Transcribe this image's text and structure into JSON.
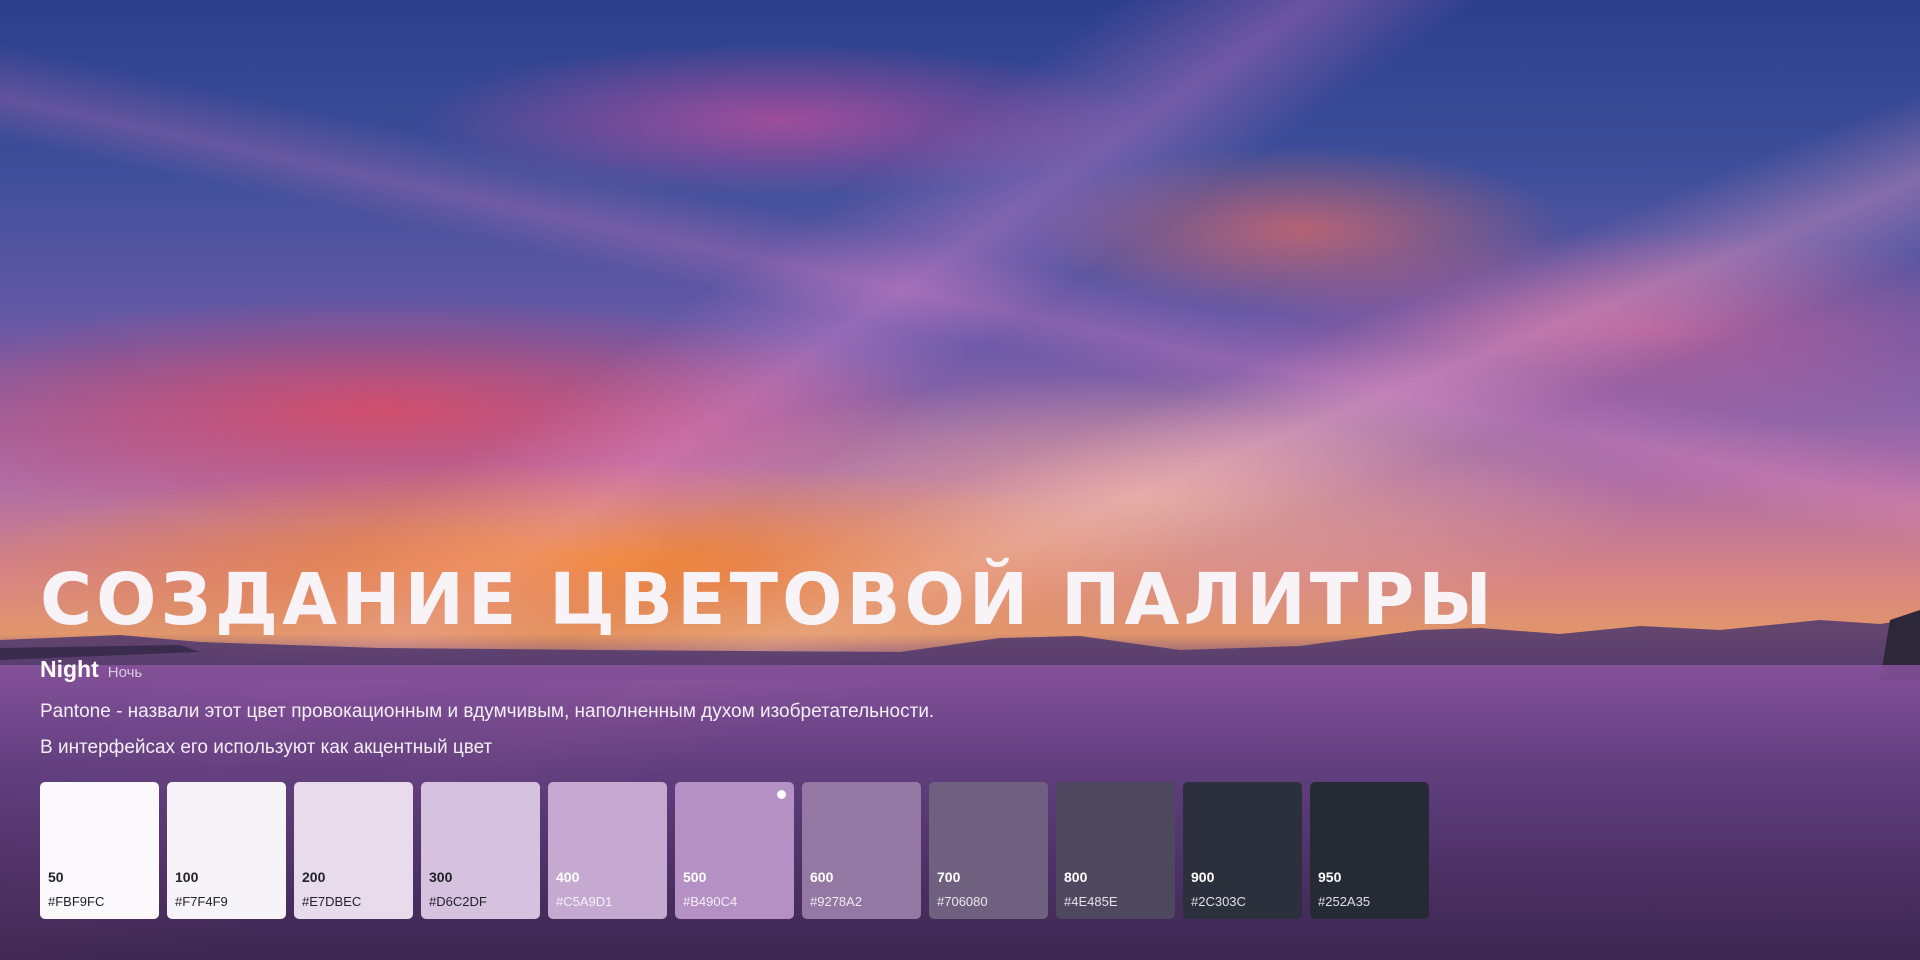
{
  "title": "СОЗДАНИЕ ЦВЕТОВОЙ ПАЛИТРЫ",
  "color_name": "Night",
  "color_name_ru": "Ночь",
  "description": [
    "Pantone - назвали этот цвет провокационным и вдумчивым, наполненным духом изобретательности.",
    "В интерфейсах его используют как акцентный цвет"
  ],
  "swatches": [
    {
      "label": "50",
      "hex": "#FBF9FC",
      "text": "dark"
    },
    {
      "label": "100",
      "hex": "#F7F4F9",
      "text": "dark"
    },
    {
      "label": "200",
      "hex": "#E7DBEC",
      "text": "dark"
    },
    {
      "label": "300",
      "hex": "#D6C2DF",
      "text": "dark"
    },
    {
      "label": "400",
      "hex": "#C5A9D1",
      "text": "light"
    },
    {
      "label": "500",
      "hex": "#B490C4",
      "text": "light",
      "selected": true
    },
    {
      "label": "600",
      "hex": "#9278A2",
      "text": "light"
    },
    {
      "label": "700",
      "hex": "#706080",
      "text": "light"
    },
    {
      "label": "800",
      "hex": "#4E485E",
      "text": "light"
    },
    {
      "label": "900",
      "hex": "#2C303C",
      "text": "light"
    },
    {
      "label": "950",
      "hex": "#252A35",
      "text": "light"
    }
  ]
}
